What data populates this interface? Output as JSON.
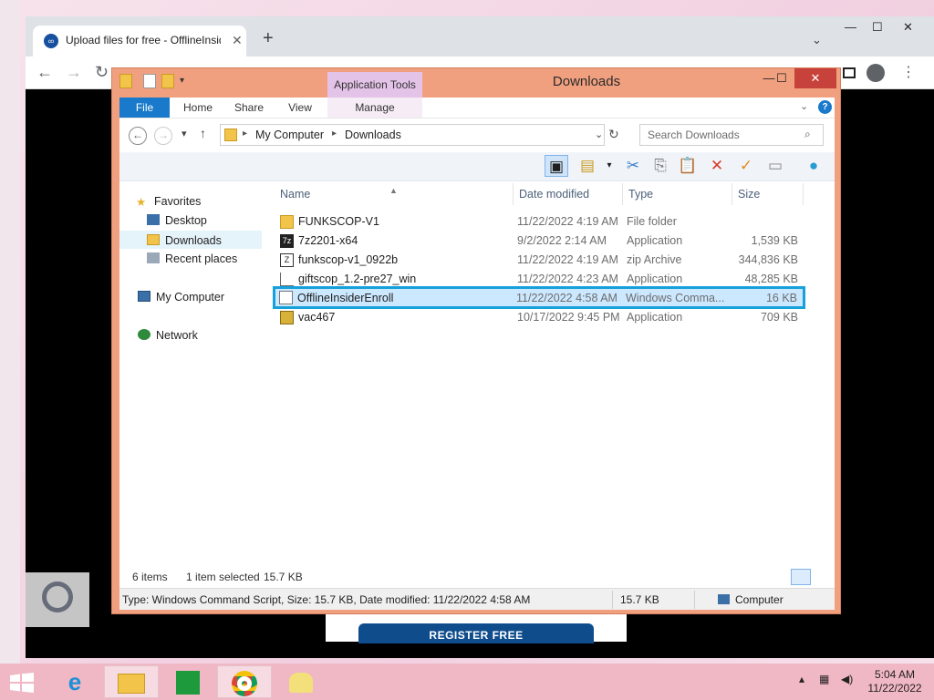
{
  "browser": {
    "tab_title": "Upload files for free - OfflineInsiderEnroll",
    "new_tab": "+",
    "register_button": "REGISTER FREE"
  },
  "explorer": {
    "title": "Downloads",
    "application_tools": "Application Tools",
    "ribbon_tabs": [
      "File",
      "Home",
      "Share",
      "View",
      "Manage"
    ],
    "breadcrumb": [
      "My Computer",
      "Downloads"
    ],
    "search_placeholder": "Search Downloads",
    "nav": {
      "favorites": "Favorites",
      "desktop": "Desktop",
      "downloads": "Downloads",
      "recent": "Recent places",
      "computer": "My Computer",
      "network": "Network"
    },
    "columns": {
      "name": "Name",
      "date": "Date modified",
      "type": "Type",
      "size": "Size"
    },
    "files": [
      {
        "name": "FUNKSCOP-V1",
        "date": "11/22/2022 4:19 AM",
        "type": "File folder",
        "size": "",
        "icon": "folder-icon"
      },
      {
        "name": "7z2201-x64",
        "date": "9/2/2022 2:14 AM",
        "type": "Application",
        "size": "1,539 KB",
        "icon": "7zip-installer-icon"
      },
      {
        "name": "funkscop-v1_0922b",
        "date": "11/22/2022 4:19 AM",
        "type": "zip Archive",
        "size": "344,836 KB",
        "icon": "zip-archive-icon"
      },
      {
        "name": "giftscop_1.2-pre27_win",
        "date": "11/22/2022 4:23 AM",
        "type": "Application",
        "size": "48,285 KB",
        "icon": "application-icon"
      },
      {
        "name": "OfflineInsiderEnroll",
        "date": "11/22/2022 4:58 AM",
        "type": "Windows Comma...",
        "size": "16 KB",
        "icon": "command-script-icon"
      },
      {
        "name": "vac467",
        "date": "10/17/2022 9:45 PM",
        "type": "Application",
        "size": "709 KB",
        "icon": "application-icon"
      }
    ],
    "status": {
      "count": "6 items",
      "selected": "1 item selected",
      "selected_size": "15.7 KB"
    },
    "details": {
      "text": "Type: Windows Command Script, Size: 15.7 KB, Date modified: 11/22/2022 4:58 AM",
      "size": "15.7 KB",
      "location": "Computer"
    }
  },
  "taskbar": {
    "time": "5:04 AM",
    "date": "11/22/2022"
  },
  "colors": {
    "explorer_frame": "#f1a07f",
    "selection_border": "#16a1db",
    "file_tab": "#1979ca",
    "taskbar": "#f0b7c4"
  }
}
